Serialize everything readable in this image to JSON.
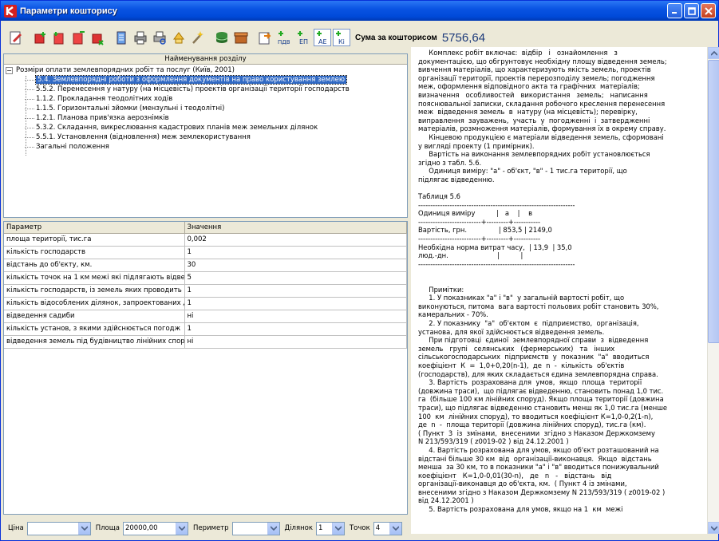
{
  "window": {
    "title": "Параметри кошторису"
  },
  "toolbar": {
    "sum_label": "Сума за кошторисом",
    "sum_value": "5756,64"
  },
  "tree": {
    "header": "Найменування розділу",
    "root": "Розміри оплати землевпорядних робіт та послуг (Київ, 2001)",
    "items": [
      "5.4. Землевпорядні роботи з оформлення документів на право користування землею",
      "5.5.2. Перенесення у натуру (на місцевість) проектів організації території господарств",
      "1.1.2. Прокладання теодолітних ходів",
      "1.1.5. Горизонтальні зйомки (мензульні і теодолітні)",
      "1.2.1. Планова прив'язка аерознімків",
      "5.3.2. Складання, викреслювання кадастрових планів меж земельних ділянок",
      "5.5.1. Установлення (відновлення) меж землекористування",
      "Загальні положення"
    ]
  },
  "params": {
    "col_param": "Параметр",
    "col_value": "Значення",
    "rows": [
      {
        "name": "площа території, тис.га",
        "value": "0,002"
      },
      {
        "name": "кількість господарств",
        "value": "1"
      },
      {
        "name": "відстань до об'єкту, км.",
        "value": "30"
      },
      {
        "name": "кількість точок на 1 км межі які підлягають відвед",
        "value": "5"
      },
      {
        "name": "кількість господарств, із земель яких проводить",
        "value": "1"
      },
      {
        "name": "кількість відособлених ділянок, запроектованих д",
        "value": "1"
      },
      {
        "name": "відведення садиби",
        "value": "ні"
      },
      {
        "name": "кількість установ, з якими здійснюється погодж",
        "value": "1"
      },
      {
        "name": "відведення земель під будівництво лінійних спору",
        "value": "ні"
      }
    ]
  },
  "bottom": {
    "price_label": "Ціна",
    "price_value": "",
    "area_label": "Площа",
    "area_value": "20000,00",
    "perimeter_label": "Периметр",
    "perimeter_value": "",
    "plot_label": "Ділянок",
    "plot_value": "1",
    "points_label": "Точок",
    "points_value": "4"
  },
  "document": {
    "lines": [
      "     Комплекс робіт включає:  відбір   і   ознайомлення   з",
      "документацією, що обгрунтовує необхідну площу відведення земель;",
      "вивчення матеріалів, що характеризують якість земель, проектів",
      "організації території, проектів перерозподілу земель; погодження",
      "меж, оформлення відповідного акта та графічних  матеріалів;",
      "визначення   особливостей   використання   земель;   написання",
      "пояснювальної записки, складання робочого креслення перенесення",
      "меж  відведення земель  в  натуру (на місцевість); перевірку,",
      "виправлення  зауважень,  участь  у  погодженні  і  затвердженні",
      "матеріалів, розмноження матеріалів, формування їх в окрему справу.",
      "     Кінцевою продукцією є матеріали відведення земель, сформовані",
      "у вигляді проекту (1 примірник).",
      "     Вартість на виконання землевпорядних робіт установлюється",
      "згідно з табл. 5.6.",
      "     Одиниця виміру: \"а\" - об'єкт, \"в\" - 1 тис.га території, що",
      "підлягає відведенню.",
      "",
      "Таблиця 5.6",
      "-----------------------------------------------------------------",
      "Одиниця виміру          |   а    |    в",
      "--------------------------+---------+-----------",
      "Вартість, грн.               | 853,5 | 2149,0",
      "--------------------------+---------+-----------",
      "Необхідна норма витрат часу,  | 13,9  | 35,0",
      "люд.-дн.                       |          |",
      "-----------------------------------------------------------------",
      "",
      "",
      "     Примітки:",
      "     1. У показниках \"а\" і \"в\"  у загальній вартості робіт, що",
      "виконуються, питома  вага вартості польових робіт становить 30%,",
      "камеральних - 70%.",
      "     2. У показнику  \"а\"  об'єктом  є  підприємство,  організація,",
      "установа, для якої здійснюється відведення земель.",
      "     При підготовці  єдиної  землевпорядної справи  з  відведення",
      "земель   групі   селянських   (фермерських)   та   інших",
      "сільськогосподарських  підприємств  у  показник  \"а\"  вводиться",
      "коефіцієнт  К  =  1,0+0,20(n-1),  де  n  -  кількість  об'єктів",
      "(господарств), для яких складається єдина землевпорядна справа.",
      "     3. Вартість  розрахована для  умов,  якщо  площа  території",
      "(довжина траси),  що підлягає відведенню, становить понад 1,0 тис.",
      "га  (більше 100 км лінійних споруд). Якщо площа території (довжина",
      "траси), що підлягає відведенню становить менш як 1,0 тис.га (менше",
      "100  км  лінійних споруд), то вводиться коефіцієнт К=1,0-0,2(1-n),",
      "де  n  -  площа території (довжина лінійних споруд), тис.га (км).",
      "( Пункт  3  із  змінами,  внесеними  згідно з Наказом Держкомзему",
      "N 213/593/319 ( z0019-02 ) від 24.12.2001 )",
      "     4. Вартість розрахована для умов, якщо об'єкт розташований на",
      "відстані більше 30 км  від  організації-виконавця.  Якщо  відстань",
      "менша  за 30 км, то в показники \"а\" і \"в\" вводиться понижувальний",
      "коефіцієнт   К=1,0-0,01(30-n),   де   n   -   відстань   від",
      "організації-виконавця до об'єкта, км.  ( Пункт 4 із змінами,",
      "внесеними згідно з Наказом Держкомзему N 213/593/319 ( z0019-02 )",
      "від 24.12.2001 )",
      "     5. Вартість розрахована для умов, якщо на 1  км  межі"
    ]
  },
  "colors": {
    "titlebar": "#0a54e3",
    "selection": "#316ac5",
    "sum_value": "#1c3a7a"
  }
}
